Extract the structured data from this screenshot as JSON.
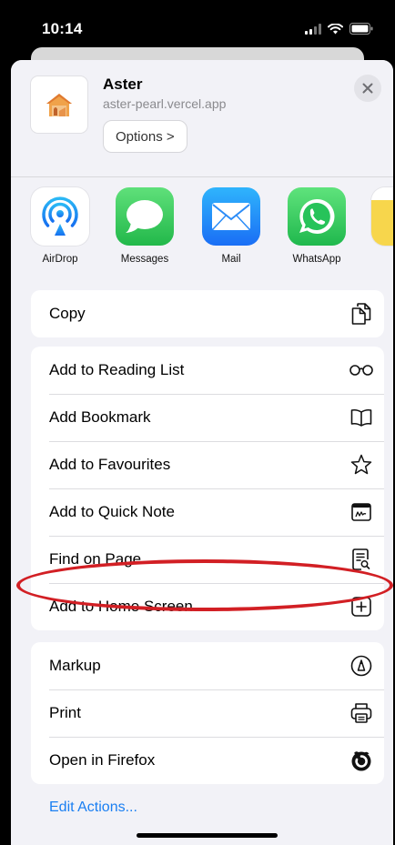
{
  "status_bar": {
    "time": "10:14"
  },
  "share_header": {
    "title": "Aster",
    "url": "aster-pearl.vercel.app",
    "options_label": "Options >"
  },
  "apps": [
    {
      "label": "AirDrop",
      "icon": "airdrop-icon"
    },
    {
      "label": "Messages",
      "icon": "messages-icon"
    },
    {
      "label": "Mail",
      "icon": "mail-icon"
    },
    {
      "label": "WhatsApp",
      "icon": "whatsapp-icon"
    }
  ],
  "groups": [
    {
      "rows": [
        {
          "label": "Copy",
          "icon": "copy-icon"
        }
      ]
    },
    {
      "rows": [
        {
          "label": "Add to Reading List",
          "icon": "glasses-icon"
        },
        {
          "label": "Add Bookmark",
          "icon": "book-icon"
        },
        {
          "label": "Add to Favourites",
          "icon": "star-icon"
        },
        {
          "label": "Add to Quick Note",
          "icon": "quick-note-icon"
        },
        {
          "label": "Find on Page",
          "icon": "find-on-page-icon"
        },
        {
          "label": "Add to Home Screen",
          "icon": "plus-square-icon"
        }
      ]
    },
    {
      "rows": [
        {
          "label": "Markup",
          "icon": "markup-icon"
        },
        {
          "label": "Print",
          "icon": "printer-icon"
        },
        {
          "label": "Open in Firefox",
          "icon": "firefox-icon"
        }
      ]
    }
  ],
  "edit_actions_label": "Edit Actions...",
  "colors": {
    "sheet_background": "#f2f2f7",
    "link_blue": "#1a7ff2",
    "highlight_red": "#d21f24",
    "messages_green": "#34c759",
    "whatsapp_green": "#25d366",
    "mail_blue": "#1e88f5"
  }
}
